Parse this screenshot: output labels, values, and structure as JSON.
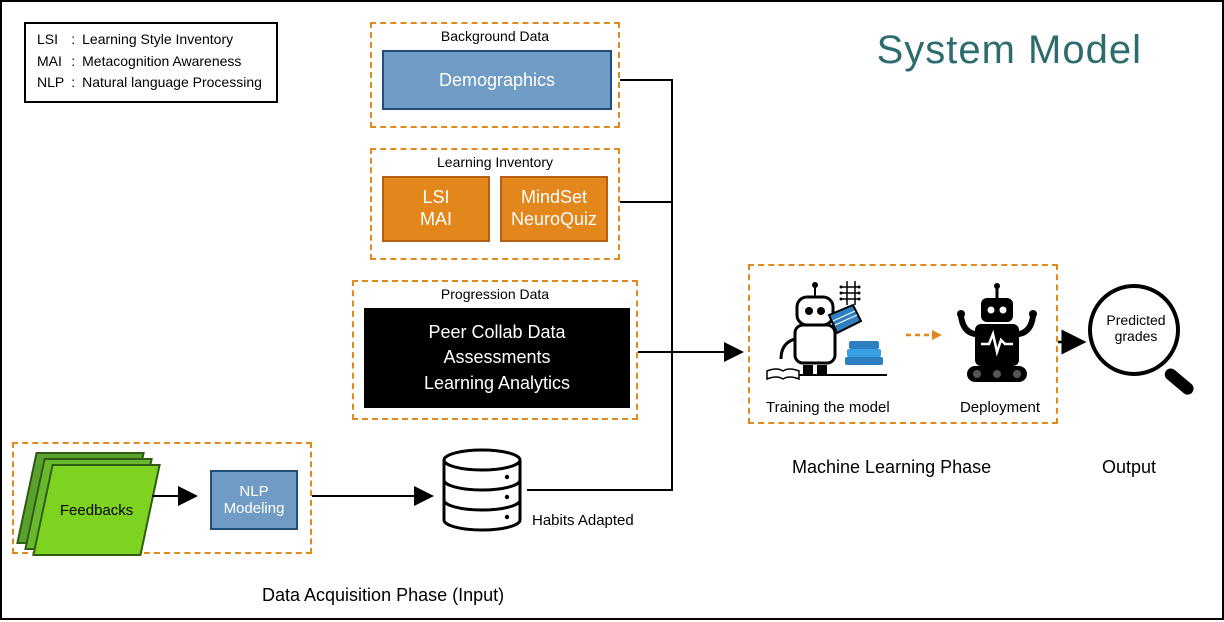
{
  "title": "System Model",
  "legend": {
    "lsi": {
      "abbr": "LSI",
      "def": "Learning Style Inventory"
    },
    "mai": {
      "abbr": "MAI",
      "def": "Metacognition Awareness"
    },
    "nlp": {
      "abbr": "NLP",
      "def": "Natural language Processing"
    }
  },
  "background_data": {
    "section": "Background Data",
    "demographics": "Demographics"
  },
  "learning_inventory": {
    "section": "Learning Inventory",
    "box1": {
      "line1": "LSI",
      "line2": "MAI"
    },
    "box2": {
      "line1": "MindSet",
      "line2": "NeuroQuiz"
    }
  },
  "progression_data": {
    "section": "Progression Data",
    "line1": "Peer Collab Data",
    "line2": "Assessments",
    "line3": "Learning Analytics"
  },
  "feedback_block": {
    "feedbacks": "Feedbacks",
    "nlp": "NLP\nModeling"
  },
  "db_label": "Habits Adapted",
  "phase_input": "Data Acquisition Phase (Input)",
  "ml": {
    "training": "Training the model",
    "deployment": "Deployment",
    "phase": "Machine Learning Phase"
  },
  "output": {
    "predicted": "Predicted\ngrades",
    "label": "Output"
  }
}
